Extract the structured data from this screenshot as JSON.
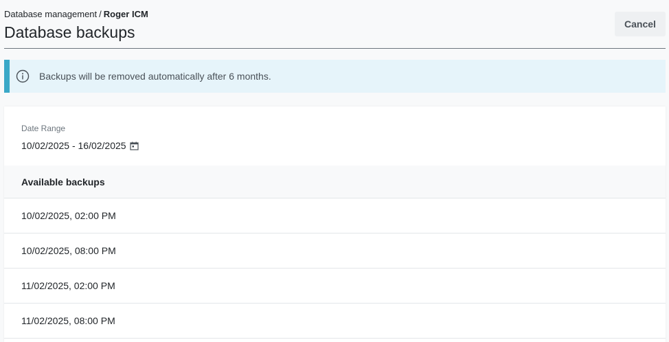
{
  "breadcrumb": {
    "parent": "Database management",
    "separator": "/",
    "current": "Roger ICM"
  },
  "page": {
    "title": "Database backups",
    "cancel_label": "Cancel"
  },
  "info": {
    "icon": "info-circle-icon",
    "message": "Backups will be removed automatically after 6 months."
  },
  "date_range": {
    "label": "Date Range",
    "value": "10/02/2025 - 16/02/2025",
    "icon": "calendar-icon"
  },
  "backups": {
    "header": "Available backups",
    "items": [
      "10/02/2025, 02:00 PM",
      "10/02/2025, 08:00 PM",
      "11/02/2025, 02:00 PM",
      "11/02/2025, 08:00 PM"
    ]
  },
  "colors": {
    "info_accent": "#3aa8c7",
    "info_background": "#e6f4fa",
    "page_background": "#f8f9fa"
  }
}
